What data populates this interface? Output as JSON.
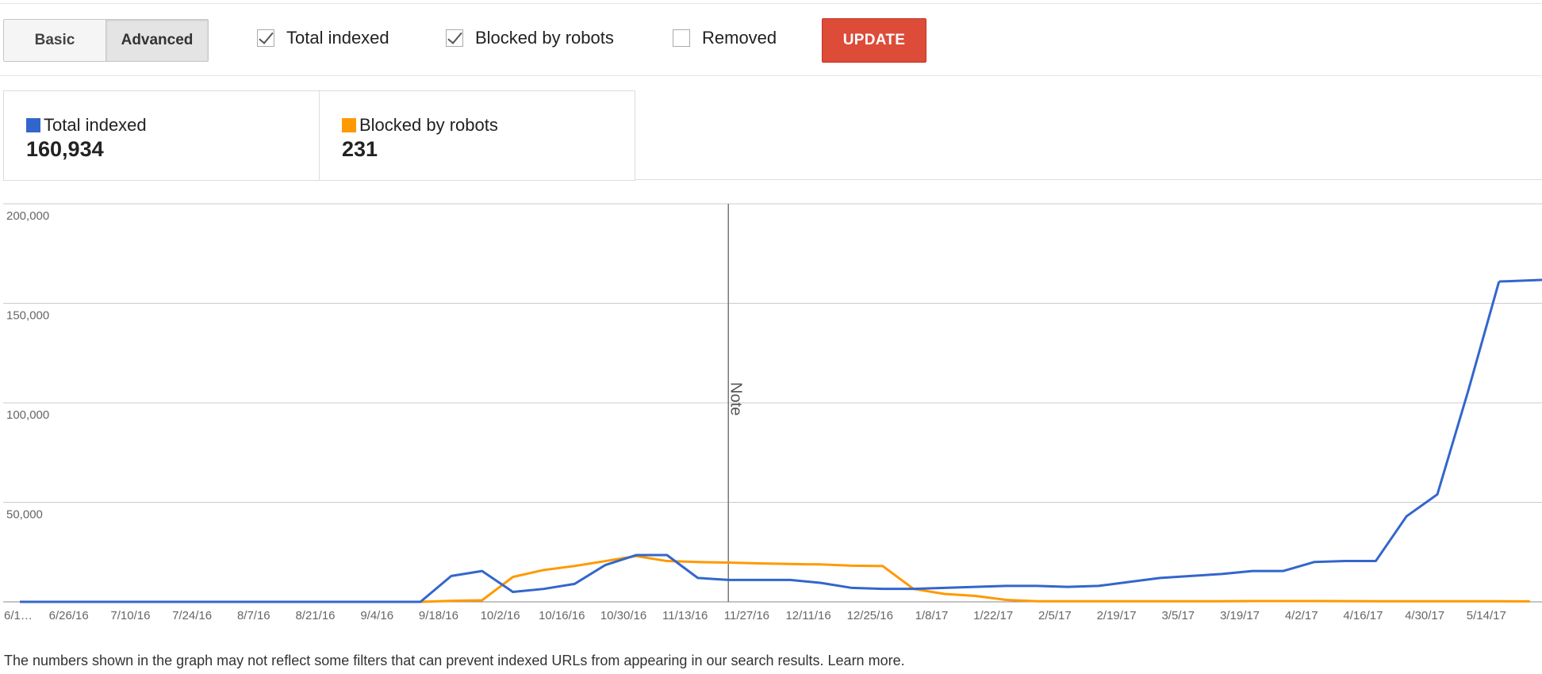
{
  "view_toggle": {
    "basic_label": "Basic",
    "advanced_label": "Advanced",
    "selected": "Advanced"
  },
  "filters": [
    {
      "label": "Total indexed",
      "checked": true
    },
    {
      "label": "Blocked by robots",
      "checked": true
    },
    {
      "label": "Removed",
      "checked": false
    }
  ],
  "update_label": "UPDATE",
  "summary": [
    {
      "label": "Total indexed",
      "value": "160,934",
      "color": "#3366cc"
    },
    {
      "label": "Blocked by robots",
      "value": "231",
      "color": "#ff9900"
    }
  ],
  "chart_data": {
    "type": "line",
    "x": [
      "6/12/16",
      "6/19/16",
      "6/26/16",
      "7/3/16",
      "7/10/16",
      "7/17/16",
      "7/24/16",
      "7/31/16",
      "8/7/16",
      "8/14/16",
      "8/21/16",
      "8/28/16",
      "9/4/16",
      "9/11/16",
      "9/18/16",
      "9/25/16",
      "10/2/16",
      "10/9/16",
      "10/16/16",
      "10/23/16",
      "10/30/16",
      "11/6/16",
      "11/13/16",
      "11/20/16",
      "11/27/16",
      "12/4/16",
      "12/11/16",
      "12/18/16",
      "12/25/16",
      "1/1/17",
      "1/8/17",
      "1/15/17",
      "1/22/17",
      "1/29/17",
      "2/5/17",
      "2/12/17",
      "2/19/17",
      "2/26/17",
      "3/5/17",
      "3/12/17",
      "3/19/17",
      "3/26/17",
      "4/2/17",
      "4/9/17",
      "4/16/17",
      "4/23/17",
      "4/30/17",
      "5/7/17",
      "5/14/17",
      "5/21/17"
    ],
    "tick_labels": [
      "6/1…",
      "6/26/16",
      "7/10/16",
      "7/24/16",
      "8/7/16",
      "8/21/16",
      "9/4/16",
      "9/18/16",
      "10/2/16",
      "10/16/16",
      "10/30/16",
      "11/13/16",
      "11/27/16",
      "12/11/16",
      "12/25/16",
      "1/8/17",
      "1/22/17",
      "2/5/17",
      "2/19/17",
      "3/5/17",
      "3/19/17",
      "4/2/17",
      "4/16/17",
      "4/30/17",
      "5/14/17"
    ],
    "tick_label_indices": [
      0,
      2,
      4,
      6,
      8,
      10,
      12,
      14,
      16,
      18,
      20,
      22,
      24,
      26,
      28,
      30,
      32,
      34,
      36,
      38,
      40,
      42,
      44,
      46,
      48
    ],
    "series": [
      {
        "name": "Total indexed",
        "color": "#3366cc",
        "values": [
          0,
          0,
          0,
          0,
          0,
          0,
          0,
          0,
          0,
          0,
          0,
          0,
          0,
          0,
          13000,
          15500,
          5000,
          6500,
          9000,
          18500,
          23500,
          23500,
          12000,
          11000,
          11000,
          11000,
          9500,
          7000,
          6500,
          6500,
          7000,
          7500,
          8000,
          8000,
          7500,
          8000,
          10000,
          12000,
          13000,
          14000,
          15500,
          15500,
          20000,
          20500,
          20500,
          43000,
          54000,
          106000,
          160934
        ]
      },
      {
        "name": "Blocked by robots",
        "color": "#ff9900",
        "values": [
          0,
          0,
          0,
          0,
          0,
          0,
          0,
          0,
          0,
          0,
          0,
          0,
          0,
          0,
          500,
          800,
          12500,
          16000,
          18000,
          20500,
          23000,
          20500,
          20000,
          19700,
          19300,
          19000,
          18800,
          18200,
          18000,
          6500,
          4000,
          3000,
          1000,
          300,
          300,
          300,
          300,
          300,
          300,
          300,
          400,
          400,
          400,
          350,
          300,
          300,
          300,
          300,
          300,
          231
        ]
      }
    ],
    "y_ticks": [
      50000,
      100000,
      150000,
      200000
    ],
    "y_tick_labels": [
      "50,000",
      "100,000",
      "150,000",
      "200,000"
    ],
    "ylim": [
      0,
      200000
    ],
    "grid": true,
    "annotation": {
      "label": "Note",
      "x": "11/20/16"
    }
  },
  "footer": {
    "text": "The numbers shown in the graph may not reflect some filters that can prevent indexed URLs from appearing in our search results.",
    "link": "Learn more."
  }
}
